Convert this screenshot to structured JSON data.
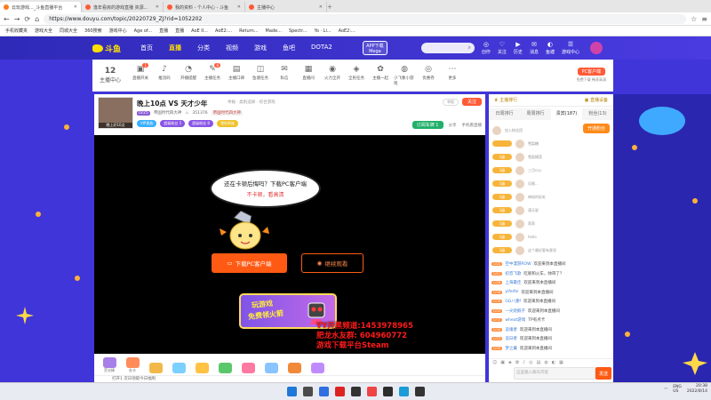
{
  "browser": {
    "tabs": [
      {
        "title": "云玩游戏..._斗鱼直播平台",
        "active": true,
        "color": "#ff7a1a"
      },
      {
        "title": "逢年看房的游戏直播 资源...",
        "active": false,
        "color": "#ff5a36"
      },
      {
        "title": "我的资料 - 个人中心 - 斗鱼",
        "active": false,
        "color": "#ff5a36"
      },
      {
        "title": "主播中心",
        "active": false,
        "color": "#ff5a36"
      }
    ],
    "url": "https://www.douyu.com/topic/20220729_ZJ?rid=1052202",
    "bookmarks": [
      "手机收藏夹",
      "游戏大全",
      "同城大全",
      "360搜索",
      "游戏中心",
      "Age of...",
      "直播",
      "直播",
      "AoE II...",
      "AoE2:...",
      "Return...",
      "Made...",
      "Spectr...",
      "Yo · Li...",
      "AoE2:..."
    ]
  },
  "site": {
    "logo": "斗鱼",
    "nav": [
      "首页",
      "直播",
      "分类",
      "视频",
      "游戏",
      "鱼吧",
      "DOTA2"
    ],
    "active_nav": "直播",
    "app_download": {
      "line1": "APP下载",
      "line2": "Mega"
    },
    "user_items": [
      {
        "icon": "◎",
        "label": "创作"
      },
      {
        "icon": "♡",
        "label": "关注"
      },
      {
        "icon": "▶",
        "label": "历史"
      },
      {
        "icon": "✉",
        "label": "消息"
      },
      {
        "icon": "◐",
        "label": "鱼塘"
      },
      {
        "icon": "☰",
        "label": "游戏中心"
      }
    ]
  },
  "toolbar": {
    "level": "12",
    "level_label": "主播中心",
    "tools": [
      {
        "icon": "▣",
        "label": "直播开关",
        "badge": "1"
      },
      {
        "icon": "♪",
        "label": "推流码",
        "badge": ""
      },
      {
        "icon": "◔",
        "label": "开播提醒",
        "badge": ""
      },
      {
        "icon": "✎",
        "label": "主播任务",
        "badge": "8"
      },
      {
        "icon": "▤",
        "label": "主播口碑",
        "badge": ""
      },
      {
        "icon": "◫",
        "label": "鱼塘任务",
        "badge": ""
      },
      {
        "icon": "✉",
        "label": "私信",
        "badge": ""
      },
      {
        "icon": "▦",
        "label": "直播间",
        "badge": ""
      },
      {
        "icon": "◉",
        "label": "火力全开",
        "badge": ""
      },
      {
        "icon": "◈",
        "label": "全民任务",
        "badge": ""
      },
      {
        "icon": "✿",
        "label": "主播一起",
        "badge": ""
      },
      {
        "icon": "◍",
        "label": "小飞象小游戏",
        "badge": ""
      },
      {
        "icon": "◎",
        "label": "优惠券",
        "badge": ""
      },
      {
        "icon": "⋯",
        "label": "更多",
        "badge": ""
      }
    ],
    "pc_client": "PC客户端",
    "pc_sub": "免费下载 畅享高清"
  },
  "room": {
    "title": "晚上10点 VS 天才少年",
    "category_line": "举报 · 类别选择 · 综合游戏",
    "avatar_label": "晚上好10点",
    "tag_level": "LV25",
    "anchor_name": "帝国时代四大神",
    "hot": "351376",
    "fan_club": "帝国时代四大神",
    "badges": [
      {
        "text": "VIP贵族",
        "color": "#3ab0ff"
      },
      {
        "text": "超级粉丝 5",
        "color": "#8a55e6"
      },
      {
        "text": "超级粉丝 8",
        "color": "#8a55e6"
      },
      {
        "text": "我的贵族",
        "color": "#f0c22a"
      }
    ],
    "report": "举报",
    "follow": "关注",
    "subscribe": "订阅车牌 1",
    "share": "分享",
    "mobile": "手机看直播"
  },
  "video": {
    "bubble_line1": "还在卡顿后悔吗？下载PC客户端",
    "bubble_line2": "不卡顿，看高清",
    "download_btn": "下载PC客户端",
    "continue_btn": "继续观看",
    "banner_line1": "玩游戏",
    "banner_line2": "免费领火箭",
    "overlay_lines": [
      "YY开黑频道:1453978965",
      "肥龙水友群: 604960772",
      "游戏下载平台Steam"
    ]
  },
  "gifts": [
    {
      "label": "荧光棒",
      "color": "#a77fe8"
    },
    {
      "label": "办卡",
      "color": "#ff8c5a"
    },
    {
      "label": "",
      "color": "#f2b94a"
    },
    {
      "label": "",
      "color": "#7ad0ff"
    },
    {
      "label": "",
      "color": "#ffc244"
    },
    {
      "label": "",
      "color": "#5ac86a"
    },
    {
      "label": "",
      "color": "#ff7aa0"
    },
    {
      "label": "",
      "color": "#8ac4ff"
    },
    {
      "label": "",
      "color": "#f08a3a"
    },
    {
      "label": "",
      "color": "#c08aff"
    }
  ],
  "bottom_text": "打开1 次日领取今日福利",
  "right_panel": {
    "top_left": "主播排行",
    "top_right": "直播设备",
    "rank_tabs": [
      "日周排行",
      "周周排行",
      "贵宾(187)",
      "粉丝(13)"
    ],
    "rank_active": "贵宾(187)",
    "join_btn": "开通粉丝",
    "fans_tip": "加入粉丝团",
    "fans": [
      {
        "badge": "",
        "name": "雪梨糖"
      },
      {
        "badge": "1级",
        "name": "雪梨榴莲"
      },
      {
        "badge": "1级",
        "name": "三月ccu"
      },
      {
        "badge": "1级",
        "name": "风雅..."
      },
      {
        "badge": "1级",
        "name": "神秘的彩虹"
      },
      {
        "badge": "1级",
        "name": "满天星"
      },
      {
        "badge": "1级",
        "name": "莉莉"
      },
      {
        "badge": "1级",
        "name": "hello"
      },
      {
        "badge": "1级",
        "name": "这个最好要有意思"
      }
    ],
    "chat": [
      {
        "lv": "LV22",
        "name": "空中漫游ROW",
        "msg": "欢迎来到本直播间"
      },
      {
        "lv": "LV21",
        "name": "初音飞歌",
        "msg": "吃呢和火车，帅哥了？"
      },
      {
        "lv": "LV28",
        "name": "上海最佳",
        "msg": "欢迎来到本直播间"
      },
      {
        "lv": "LV16",
        "name": "yifeifei",
        "msg": "欢迎来到本直播间"
      },
      {
        "lv": "LV19",
        "name": "GG八重f",
        "msg": "欢迎来到本直播间"
      },
      {
        "lv": "LV10",
        "name": "一尖烧鹅子",
        "msg": "欢迎来到本直播间"
      },
      {
        "lv": "LV17",
        "name": "wheat游戏",
        "msg": "TP有点卡"
      },
      {
        "lv": "LV10",
        "name": "追魂者",
        "msg": "欢迎来到本直播间"
      },
      {
        "lv": "LV23",
        "name": "追日者",
        "msg": "欢迎来到本直播间"
      },
      {
        "lv": "LV15",
        "name": "梦之翼",
        "msg": "欢迎来到本直播间"
      }
    ],
    "input_placeholder": "这里输入聊天内容",
    "send": "发送",
    "tool_icons": [
      "☺",
      "▣",
      "◈",
      "✿",
      "♪",
      "◎",
      "▤",
      "◍",
      "◐",
      "▦"
    ]
  },
  "taskbar": {
    "icons": [
      "#1e78d7",
      "#4b4b4b",
      "#2f6fe0",
      "#d22",
      "#333",
      "#e44",
      "#2c2c2c",
      "#1b9bd7",
      "#333"
    ],
    "lang": "ENG",
    "lang2": "US",
    "time": "20:38",
    "date": "2022/8/14"
  }
}
